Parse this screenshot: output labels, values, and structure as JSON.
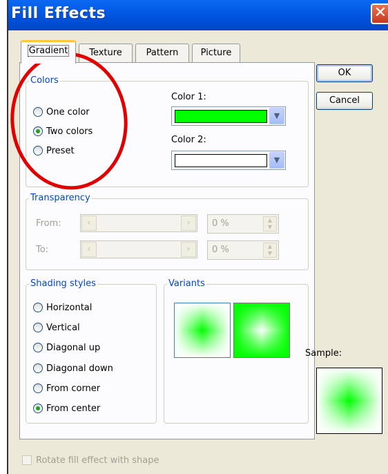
{
  "window": {
    "title": "Fill Effects",
    "close_label": "✕"
  },
  "tabs": [
    {
      "label": "Gradient",
      "active": true
    },
    {
      "label": "Texture",
      "active": false
    },
    {
      "label": "Pattern",
      "active": false
    },
    {
      "label": "Picture",
      "active": false
    }
  ],
  "colors_group": {
    "legend": "Colors",
    "options": [
      {
        "label": "One color",
        "selected": false
      },
      {
        "label": "Two colors",
        "selected": true
      },
      {
        "label": "Preset",
        "selected": false
      }
    ],
    "color1": {
      "label": "Color 1:",
      "value_hex": "#00ff00"
    },
    "color2": {
      "label": "Color 2:",
      "value_hex": "#ffffff"
    }
  },
  "transparency_group": {
    "legend": "Transparency",
    "from": {
      "label": "From:",
      "value": "0 %"
    },
    "to": {
      "label": "To:",
      "value": "0 %"
    }
  },
  "shading_group": {
    "legend": "Shading styles",
    "options": [
      {
        "label": "Horizontal",
        "selected": false
      },
      {
        "label": "Vertical",
        "selected": false
      },
      {
        "label": "Diagonal up",
        "selected": false
      },
      {
        "label": "Diagonal down",
        "selected": false
      },
      {
        "label": "From corner",
        "selected": false
      },
      {
        "label": "From center",
        "selected": true
      }
    ]
  },
  "variants_group": {
    "legend": "Variants",
    "selected_index": 0
  },
  "buttons": {
    "ok": "OK",
    "cancel": "Cancel"
  },
  "sample": {
    "label": "Sample:"
  },
  "rotate_checkbox": {
    "label": "Rotate fill effect with shape",
    "checked": false,
    "enabled": false
  },
  "annotation": {
    "color": "#e00000",
    "shape": "ellipse"
  },
  "colors": {
    "title_bar": "#0058e6",
    "accent_green": "#00ff00",
    "legend_blue": "#0046d5"
  }
}
